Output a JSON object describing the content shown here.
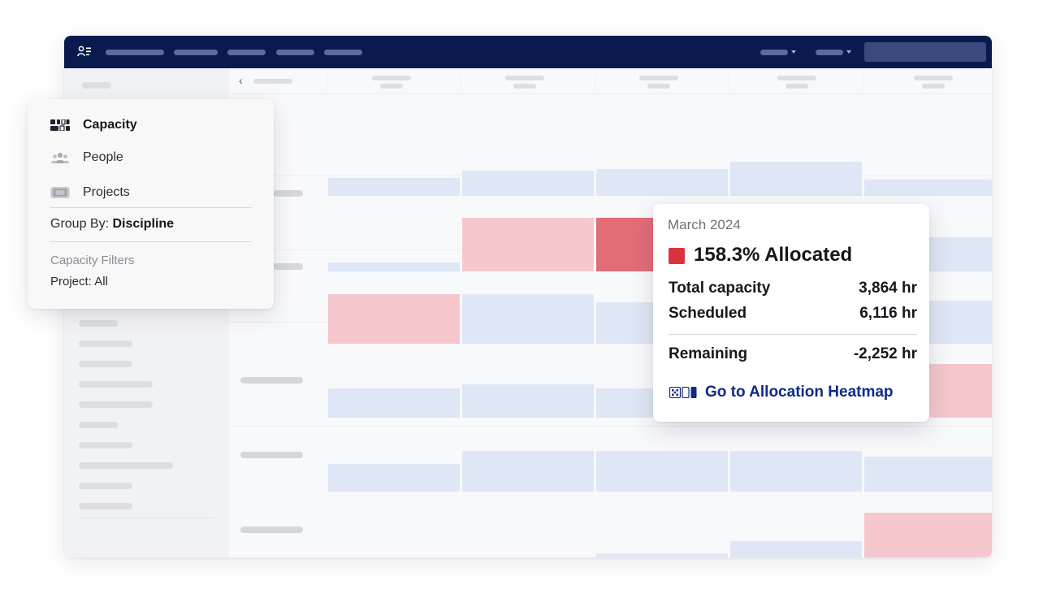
{
  "panel": {
    "items": [
      {
        "label": "Capacity",
        "icon": "capacity-grid-icon",
        "active": true
      },
      {
        "label": "People",
        "icon": "people-icon",
        "active": false
      },
      {
        "label": "Projects",
        "icon": "projects-icon",
        "active": false
      }
    ],
    "group_by_label": "Group By:",
    "group_by_value": "Discipline",
    "filters_title": "Capacity Filters",
    "filters_project": "Project: All"
  },
  "tooltip": {
    "month": "March 2024",
    "allocated": "158.3% Allocated",
    "status_color": "#d9333e",
    "total_capacity_label": "Total capacity",
    "total_capacity_value": "3,864 hr",
    "scheduled_label": "Scheduled",
    "scheduled_value": "6,116 hr",
    "remaining_label": "Remaining",
    "remaining_value": "-2,252 hr",
    "link_label": "Go to Allocation Heatmap",
    "link_icon": "heatmap-icon"
  },
  "colors": {
    "topbar": "#0a1a4f",
    "under_allocated": "#dfe6f5",
    "over_allocated": "#f6c7cc",
    "highly_over_allocated": "#e36d77",
    "link": "#0d2a86"
  }
}
